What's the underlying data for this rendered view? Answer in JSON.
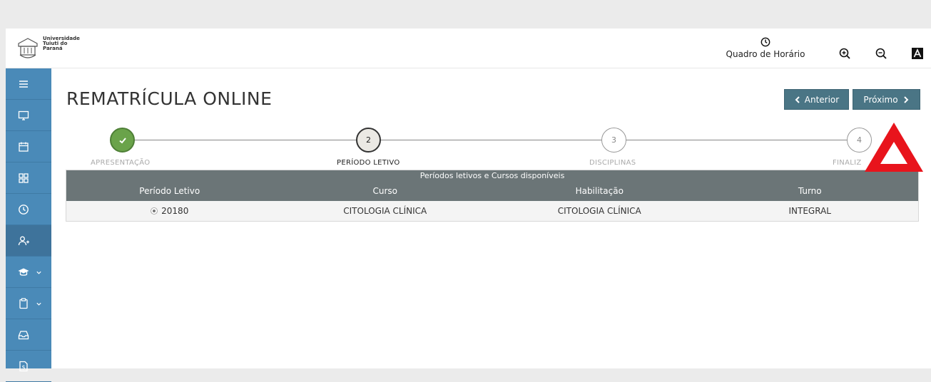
{
  "header": {
    "logo_text": [
      "Universidade",
      "Tuiuti do",
      "Paraná"
    ],
    "schedule_label": "Quadro de Horário",
    "icons": [
      "clock-icon",
      "zoom-in-icon",
      "zoom-out-icon",
      "contrast-icon"
    ]
  },
  "sidebar": {
    "icons": [
      "menu-icon",
      "monitor-icon",
      "calendar-icon",
      "grid-icon",
      "clock-icon",
      "user-add-icon",
      "graduation-cap-icon",
      "clipboard-icon",
      "inbox-icon",
      "dollar-file-icon"
    ]
  },
  "page": {
    "title": "REMATRÍCULA ONLINE",
    "prev_label": "Anterior",
    "next_label": "Próximo"
  },
  "stepper": {
    "steps": [
      {
        "number": "✓",
        "label": "APRESENTAÇÃO",
        "state": "done"
      },
      {
        "number": "2",
        "label": "PERÍODO LETIVO",
        "state": "current"
      },
      {
        "number": "3",
        "label": "DISCIPLINAS",
        "state": "pending"
      },
      {
        "number": "4",
        "label": "FINALIZ",
        "state": "pending"
      }
    ]
  },
  "table": {
    "caption": "Períodos letivos e Cursos disponíveis",
    "headers": [
      "Período Letivo",
      "Curso",
      "Habilitação",
      "Turno"
    ],
    "rows": [
      [
        "20180",
        "CITOLOGIA CLÍNICA",
        "CITOLOGIA CLÍNICA",
        "INTEGRAL"
      ]
    ]
  },
  "colors": {
    "sidebar": "#4a8ab8",
    "button": "#4a7585",
    "table_header": "#6b7577",
    "step_done": "#6aa34a",
    "warning": "#e8141c"
  }
}
